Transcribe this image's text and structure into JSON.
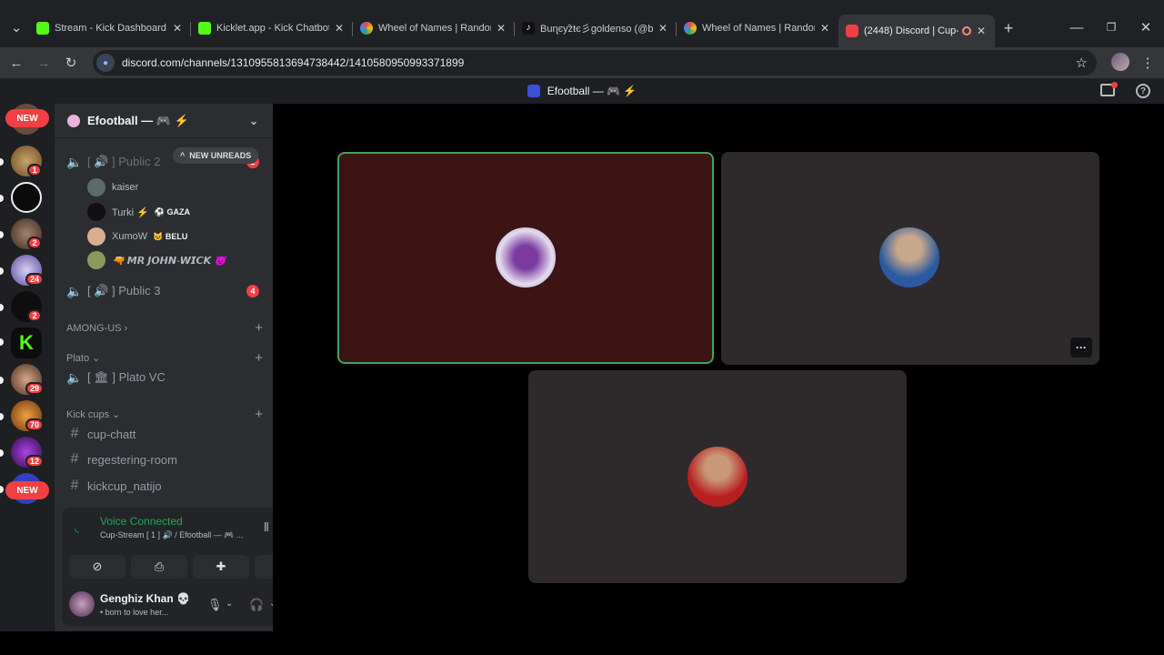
{
  "browser": {
    "tabs": [
      {
        "title": "Stream - Kick Dashboard",
        "favcolor": "#53fc18"
      },
      {
        "title": "Kicklet.app - Kick Chatbot",
        "favcolor": "#53fc18"
      },
      {
        "title": "Wheel of Names | Random",
        "favcolor": "#e84a4a"
      },
      {
        "title": "Buɳєу̃zŧє彡goldenso (@bu",
        "favcolor": "#ffffff"
      },
      {
        "title": "Wheel of Names | Random",
        "favcolor": "#e84a4a"
      },
      {
        "title": "(2448) Discord | Cup-St",
        "favcolor": "#f23f43"
      }
    ],
    "url": "discord.com/channels/1310955813694738442/1410580950993371899",
    "new_tab_label": "+"
  },
  "discord": {
    "window_title": "Efootball — 🎮 ⚡",
    "guild_name": "Efootball — 🎮 ⚡",
    "new_unreads": "NEW UNREADS",
    "rail": {
      "new_top": "NEW",
      "new_bottom": "NEW",
      "badges": [
        "1",
        "2",
        "24",
        "2",
        "29",
        "70",
        "12"
      ]
    },
    "channels": {
      "public_partial": "[ 🔊 ] Public 2",
      "public_partial_badge": "2",
      "members": [
        {
          "name": "kaiser",
          "tag": ""
        },
        {
          "name": "Turki ⚡",
          "tag": "⚽ GAZA"
        },
        {
          "name": "XumoW",
          "tag": "🐱 BELU"
        },
        {
          "name": "🔫 𝙈𝙍 𝙅𝙊𝙃𝙉-𝙒𝙄𝘾𝙆 😈",
          "tag": ""
        }
      ],
      "public3": "[ 🔊 ]  Public 3",
      "public3_badge": "4",
      "cat_among": "AMONG-US ›",
      "cat_plato": "Plato ⌄",
      "plato_vc": "[ 🏛 ] Plato VC",
      "cat_kick": "Kick cups ⌄",
      "text_channels": [
        "cup-chatt",
        "regestering-room",
        "kickcup_natijo"
      ]
    },
    "voice": {
      "status": "Voice Connected",
      "location": "Cup-Stream [ 1 ] 🔊 / Efootball — 🎮 ..."
    },
    "user": {
      "name": "Genghiz Khan 💀",
      "status": "• born to love her..."
    },
    "stage": {
      "more_label": "···"
    },
    "colors": {
      "speaking_border": "#3ba55d",
      "tile_active": "#3d1414",
      "tile_idle": "#2e2a2c"
    }
  }
}
